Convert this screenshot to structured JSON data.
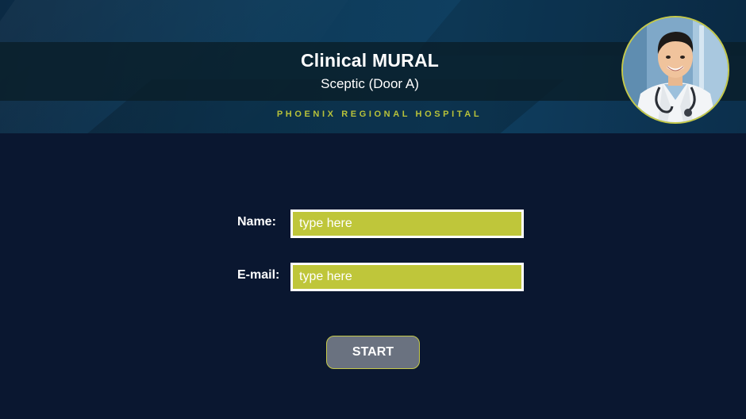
{
  "header": {
    "title": "Clinical MURAL",
    "subtitle": "Sceptic (Door A)",
    "organization": "PHOENIX REGIONAL HOSPITAL",
    "avatar_icon": "doctor-photo"
  },
  "form": {
    "name_label": "Name:",
    "name_placeholder": "type here",
    "email_label": "E-mail:",
    "email_placeholder": "type here"
  },
  "actions": {
    "start_label": "START"
  },
  "colors": {
    "background": "#0a1730",
    "accent": "#bfc63a",
    "button": "#6a7280",
    "text": "#ffffff"
  }
}
